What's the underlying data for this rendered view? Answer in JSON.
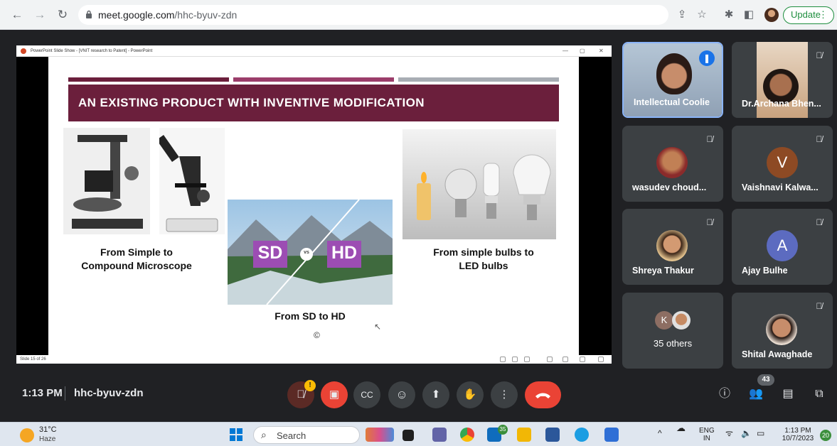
{
  "browser": {
    "url_host": "meet.google.com",
    "url_path": "/hhc-byuv-zdn",
    "update_label": "Update"
  },
  "powerpoint": {
    "window_title": "PowerPoint Slide Show - [VNIT research to Patent] - PowerPoint",
    "slide_status": "Slide 15 of 26"
  },
  "slide": {
    "title": "AN EXISTING PRODUCT WITH INVENTIVE MODIFICATION",
    "caption_microscope_1": "From Simple to",
    "caption_microscope_2": "Compound Microscope",
    "caption_bulbs_1": "From simple bulbs to",
    "caption_bulbs_2": "LED bulbs",
    "sd_label": "SD",
    "vs_label": "vs",
    "hd_label": "HD",
    "caption_sdhd": "From SD to HD",
    "copyright": "©",
    "colors": {
      "banner": "#6b1f3c",
      "stripe_1": "#6b1f3c",
      "stripe_2": "#9b3d6a",
      "stripe_3": "#a8adb4"
    }
  },
  "participants": [
    {
      "name": "Intellectual Coolie",
      "speaking": true
    },
    {
      "name": "Dr.Archana Bhen...",
      "muted": true
    },
    {
      "name": "wasudev choud...",
      "muted": true
    },
    {
      "name": "Vaishnavi Kalwa...",
      "muted": true,
      "initial": "V",
      "color": "#8d4a24"
    },
    {
      "name": "Shreya Thakur",
      "muted": true
    },
    {
      "name": "Ajay Bulhe",
      "muted": true,
      "initial": "A",
      "color": "#5c6bc0"
    },
    {
      "name": "35 others",
      "initial": "K",
      "color": "#8d6e63"
    },
    {
      "name": "Shital Awaghade",
      "muted": true
    }
  ],
  "meeting": {
    "time": "1:13 PM",
    "code": "hhc-byuv-zdn",
    "people_count": "43",
    "mic_alert": "!"
  },
  "taskbar": {
    "weather_temp": "31°C",
    "weather_desc": "Haze",
    "search_label": "Search",
    "lang_1": "ENG",
    "lang_2": "IN",
    "clock_time": "1:13 PM",
    "clock_date": "10/7/2023",
    "notification_count": "20",
    "mail_badge": "35"
  }
}
